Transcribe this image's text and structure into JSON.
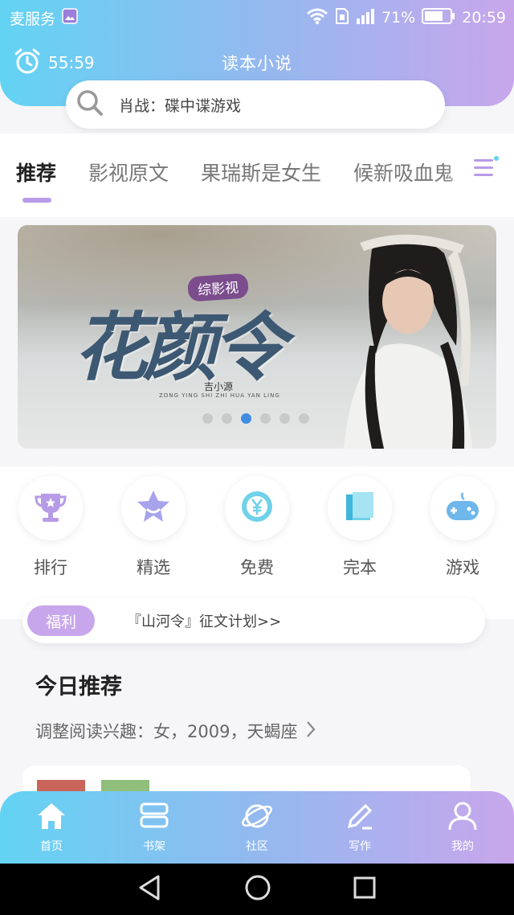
{
  "status_bar": {
    "carrier": "麦服务",
    "battery_percent": "71%",
    "time": "20:59"
  },
  "header": {
    "timer": "55:59",
    "app_title": "读本小说"
  },
  "search": {
    "text": "肖战：碟中谍游戏"
  },
  "tabs": [
    {
      "label": "推荐",
      "active": true
    },
    {
      "label": "影视原文",
      "active": false
    },
    {
      "label": "果瑞斯是女生",
      "active": false
    },
    {
      "label": "候新吸血鬼",
      "active": false
    }
  ],
  "banner": {
    "badge": "综影视",
    "title": "花颜令",
    "author": "吉小源",
    "pinyin": "ZONG YING SHI ZHI HUA YAN LING",
    "dots": 6,
    "active_dot": 2
  },
  "categories": [
    {
      "label": "排行",
      "icon": "trophy-icon"
    },
    {
      "label": "精选",
      "icon": "star-icon"
    },
    {
      "label": "免费",
      "icon": "yen-icon"
    },
    {
      "label": "完本",
      "icon": "book-icon"
    },
    {
      "label": "游戏",
      "icon": "gamepad-icon"
    }
  ],
  "welfare": {
    "badge": "福利",
    "text": "『山河令』征文计划>>"
  },
  "today": {
    "title": "今日推荐",
    "subtitle": "调整阅读兴趣：女，2009，天蝎座"
  },
  "bottom_nav": [
    {
      "label": "首页",
      "icon": "home-icon"
    },
    {
      "label": "书架",
      "icon": "bookshelf-icon"
    },
    {
      "label": "社区",
      "icon": "planet-icon"
    },
    {
      "label": "写作",
      "icon": "pen-icon"
    },
    {
      "label": "我的",
      "icon": "profile-icon"
    }
  ],
  "colors": {
    "gradient_start": "#63d3f3",
    "gradient_end": "#c8a6ec",
    "accent_purple": "#b79be6",
    "active_dot": "#3f8de0"
  }
}
